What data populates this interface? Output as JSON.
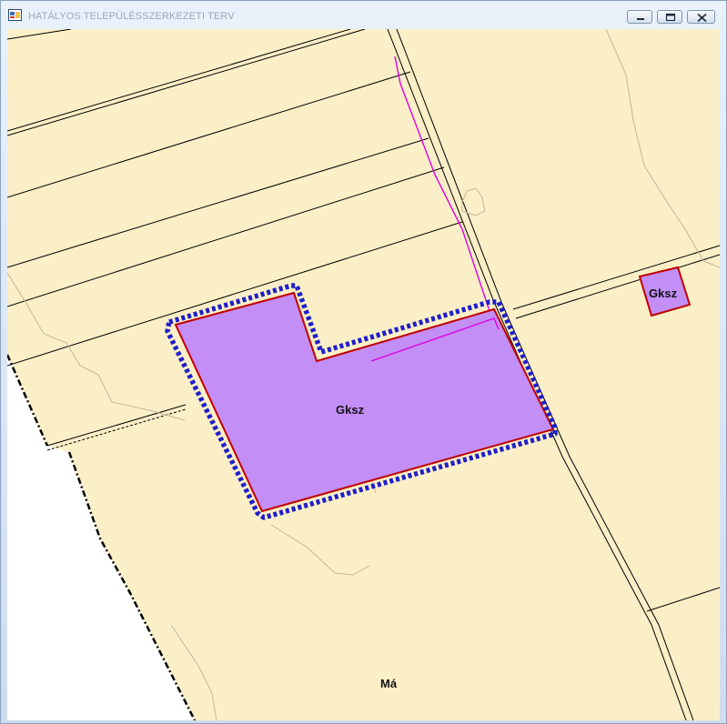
{
  "window": {
    "title": "HATÁLYOS TELEPÜLÉSSZERKEZETI TERV",
    "icons": [
      "app-map-icon",
      "minimize-icon",
      "restore-icon",
      "close-icon"
    ]
  },
  "map": {
    "labels": {
      "zone_main": "Gksz",
      "zone_small": "Gksz",
      "zone_south": "Má"
    },
    "colors": {
      "background_land": "#fbefc7",
      "outside_area": "#ffffff",
      "zone_fill": "#c38ef5",
      "zone_border": "#c00000",
      "selection_outline": "#1f1fc9",
      "utility_line": "#e000e0",
      "terrain_line": "#c8b49a",
      "parcel_line": "#000000"
    }
  }
}
